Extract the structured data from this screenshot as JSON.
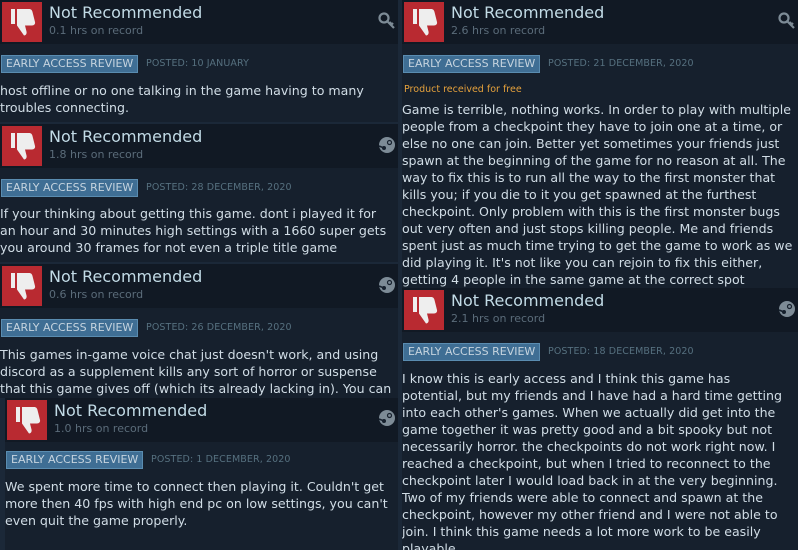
{
  "reviews": [
    {
      "title": "Not Recommended",
      "hours": "0.1 hrs on record",
      "source_icon": "key-icon",
      "tag": "EARLY ACCESS REVIEW",
      "posted": "POSTED: 10 JANUARY",
      "product_note": "",
      "body": "host offline or no one talking in the game having to many troubles connecting."
    },
    {
      "title": "Not Recommended",
      "hours": "2.6 hrs on record",
      "source_icon": "key-icon",
      "tag": "EARLY ACCESS REVIEW",
      "posted": "POSTED: 21 DECEMBER, 2020",
      "product_note": "Product received for free",
      "body": "Game is terrible, nothing works. In order to play with multiple people from a checkpoint they have to join one at a time, or else no one can join. Better yet sometimes your friends just spawn at the beginning of the game for no reason at all. The way to fix this is to run all the way to the first monster that kills you; if you die to it you get spawned at the furthest checkpoint. Only problem with this is the first monster bugs out very often and just stops killing people. Me and friends spent just as much time trying to get the game to work as we did playing it. It's not like you can rejoin to fix this either, getting 4 people in the same game at the correct spot requires a christmas miracle. This is all"
    },
    {
      "title": "Not Recommended",
      "hours": "1.8 hrs on record",
      "source_icon": "steam-icon",
      "tag": "EARLY ACCESS REVIEW",
      "posted": "POSTED: 28 DECEMBER, 2020",
      "product_note": "",
      "body": "If your thinking about getting this game. dont i played it for an hour and 30 minutes high settings with a 1660 super gets you around 30 frames for not even a triple title game"
    },
    {
      "title": "Not Recommended",
      "hours": "0.6 hrs on record",
      "source_icon": "steam-icon",
      "tag": "EARLY ACCESS REVIEW",
      "posted": "POSTED: 26 DECEMBER, 2020",
      "product_note": "",
      "body": "This games in-game voice chat just doesn't work, and using discord as a supplement kills any sort of horror or suspense that this game gives off (which its already lacking in). You can tell"
    },
    {
      "title": "Not Recommended",
      "hours": "2.1 hrs on record",
      "source_icon": "steam-icon",
      "tag": "EARLY ACCESS REVIEW",
      "posted": "POSTED: 18 DECEMBER, 2020",
      "product_note": "",
      "body": "I know this is early access and I think this game has potential, but my friends and I have had a hard time getting into each other's games. When we actually did get into the game together it was pretty good and a bit spooky but not necessarily horror. the checkpoints do not work right now. I reached a checkpoint, but when I tried to reconnect to the checkpoint later I would load back in at the very beginning. Two of my friends were able to connect and spawn at the checkpoint, however my other friend and I were not able to join. I think this game needs a lot more work to be easily playable."
    },
    {
      "title": "Not Recommended",
      "hours": "1.0 hrs on record",
      "source_icon": "steam-icon",
      "tag": "EARLY ACCESS REVIEW",
      "posted": "POSTED: 1 DECEMBER, 2020",
      "product_note": "",
      "body": "We spent more time to connect then playing it. Couldn't get more then 40 fps with high end pc on low settings, you can't even quit the game properly."
    }
  ],
  "colors": {
    "page_bg": "#1b2838",
    "card_bg": "#16202d",
    "thumb_red": "#b92a31",
    "tag_blue": "#3f6e94",
    "free_orange": "#e5a13c"
  }
}
